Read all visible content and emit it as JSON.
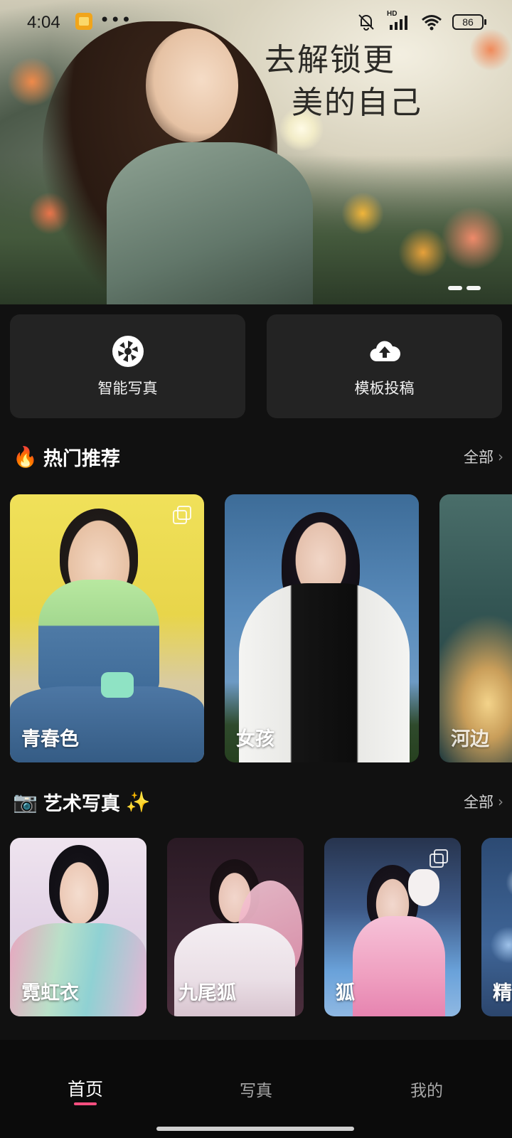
{
  "status_bar": {
    "time": "4:04",
    "more": "•••",
    "network": "HD",
    "battery": "86"
  },
  "banner": {
    "slogan_line1": "去解锁更",
    "slogan_line2": "美的自己",
    "active_slide": 2,
    "slide_count": 2
  },
  "actions": [
    {
      "label": "智能写真",
      "icon": "camera-aperture-icon"
    },
    {
      "label": "模板投稿",
      "icon": "cloud-upload-icon"
    }
  ],
  "hot": {
    "title": "热门推荐",
    "emoji": "🔥",
    "see_all": "全部",
    "cards": [
      "青春色",
      "女孩",
      "河边"
    ]
  },
  "art": {
    "title": "艺术写真",
    "emoji_left": "📷",
    "emoji_right": "✨",
    "see_all": "全部",
    "cards": [
      "霓虹衣",
      "九尾狐",
      "狐",
      "精"
    ]
  },
  "nav": {
    "items": [
      "首页",
      "写真",
      "我的"
    ],
    "active": "首页"
  },
  "colors": {
    "background": "#111111",
    "card": "#232323",
    "accent": "#ff4f80"
  }
}
